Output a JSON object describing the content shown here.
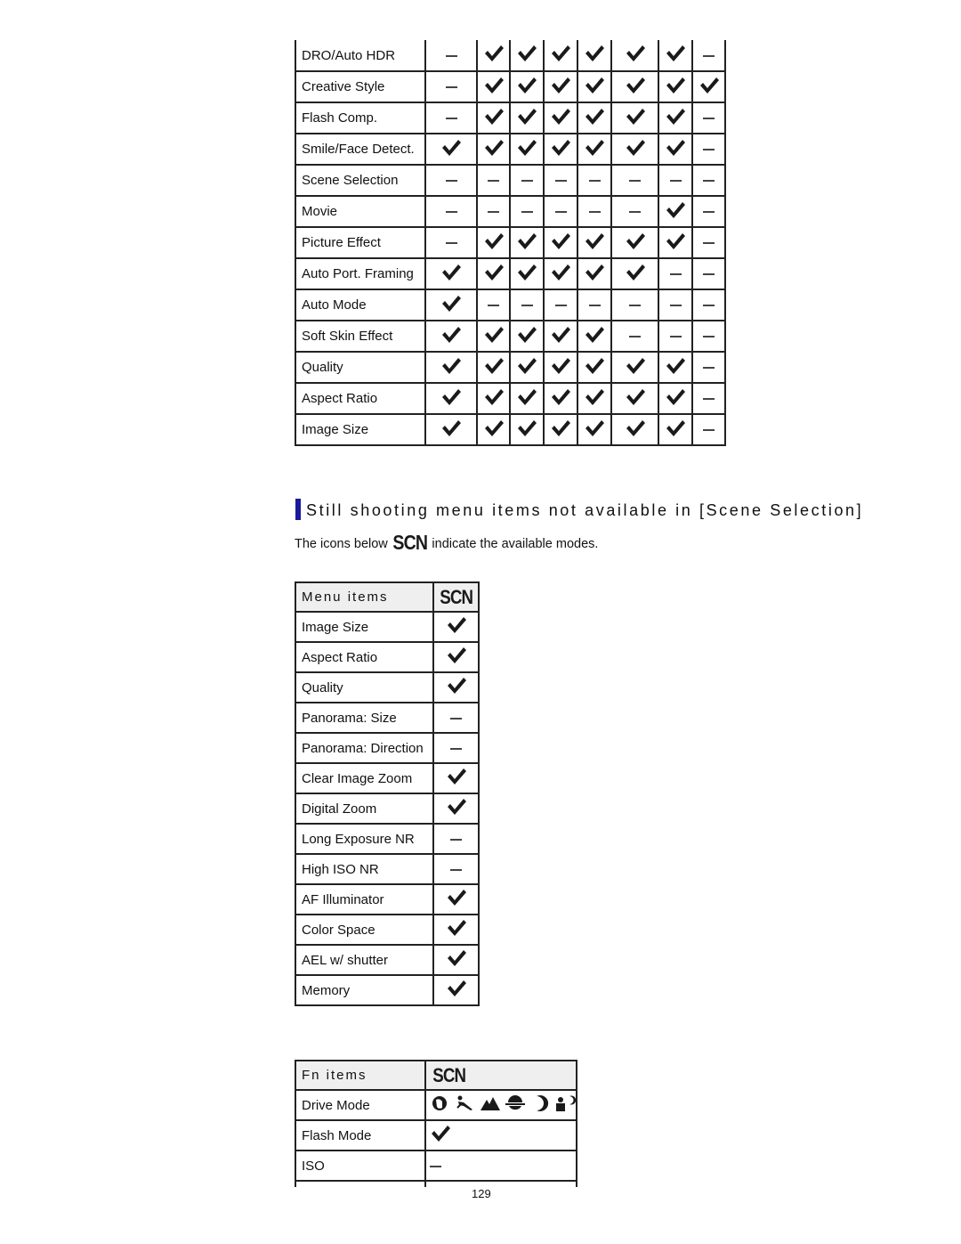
{
  "table1": {
    "rows": [
      {
        "label": "DRO/Auto HDR",
        "cells": [
          "-",
          "y",
          "y",
          "y",
          "y",
          "y",
          "y",
          "-"
        ]
      },
      {
        "label": "Creative Style",
        "cells": [
          "-",
          "y",
          "y",
          "y",
          "y",
          "y",
          "y",
          "y"
        ]
      },
      {
        "label": "Flash Comp.",
        "cells": [
          "-",
          "y",
          "y",
          "y",
          "y",
          "y",
          "y",
          "-"
        ]
      },
      {
        "label": "Smile/Face Detect.",
        "cells": [
          "y",
          "y",
          "y",
          "y",
          "y",
          "y",
          "y",
          "-"
        ]
      },
      {
        "label": "Scene Selection",
        "cells": [
          "-",
          "-",
          "-",
          "-",
          "-",
          "-",
          "-",
          "-"
        ]
      },
      {
        "label": "Movie",
        "cells": [
          "-",
          "-",
          "-",
          "-",
          "-",
          "-",
          "y",
          "-"
        ]
      },
      {
        "label": "Picture Effect",
        "cells": [
          "-",
          "y",
          "y",
          "y",
          "y",
          "y",
          "y",
          "-"
        ]
      },
      {
        "label": "Auto Port. Framing",
        "cells": [
          "y",
          "y",
          "y",
          "y",
          "y",
          "y",
          "-",
          "-"
        ]
      },
      {
        "label": "Auto Mode",
        "cells": [
          "y",
          "-",
          "-",
          "-",
          "-",
          "-",
          "-",
          "-"
        ]
      },
      {
        "label": "Soft Skin Effect",
        "cells": [
          "y",
          "y",
          "y",
          "y",
          "y",
          "-",
          "-",
          "-"
        ]
      },
      {
        "label": "Quality",
        "cells": [
          "y",
          "y",
          "y",
          "y",
          "y",
          "y",
          "y",
          "-"
        ]
      },
      {
        "label": "Aspect Ratio",
        "cells": [
          "y",
          "y",
          "y",
          "y",
          "y",
          "y",
          "y",
          "-"
        ]
      },
      {
        "label": "Image Size",
        "cells": [
          "y",
          "y",
          "y",
          "y",
          "y",
          "y",
          "y",
          "-"
        ]
      }
    ]
  },
  "section": {
    "title": "Still shooting menu items not available in [Scene Selection]",
    "intro_before": "The icons below",
    "intro_icon": "SCN",
    "intro_after": "indicate the available modes."
  },
  "table2": {
    "header_label": "Menu items",
    "header_mode": "SCN",
    "rows": [
      {
        "label": "Image Size",
        "value": "y"
      },
      {
        "label": "Aspect Ratio",
        "value": "y"
      },
      {
        "label": "Quality",
        "value": "y"
      },
      {
        "label": "Panorama: Size",
        "value": "-"
      },
      {
        "label": "Panorama: Direction",
        "value": "-"
      },
      {
        "label": "Clear Image Zoom",
        "value": "y"
      },
      {
        "label": "Digital Zoom",
        "value": "y"
      },
      {
        "label": "Long Exposure NR",
        "value": "-"
      },
      {
        "label": "High ISO NR",
        "value": "-"
      },
      {
        "label": "AF Illuminator",
        "value": "y"
      },
      {
        "label": "Color Space",
        "value": "y"
      },
      {
        "label": "AEL w/ shutter",
        "value": "y"
      },
      {
        "label": "Memory",
        "value": "y"
      }
    ]
  },
  "table3": {
    "header_label": "Fn items",
    "header_mode": "SCN",
    "rows": [
      {
        "label": "Drive Mode",
        "value": "icons",
        "icons": [
          "portrait-icon",
          "sports-action-icon",
          "landscape-icon",
          "sunset-icon",
          "night-scene-icon",
          "night-portrait-icon"
        ]
      },
      {
        "label": "Flash Mode",
        "value": "y"
      },
      {
        "label": "ISO",
        "value": "-"
      },
      {
        "label": "",
        "value": ""
      }
    ]
  },
  "page_number": "129",
  "colors": {
    "accent_bar": "#1a1a9a",
    "header_bg": "#efefef",
    "border": "#222222"
  }
}
